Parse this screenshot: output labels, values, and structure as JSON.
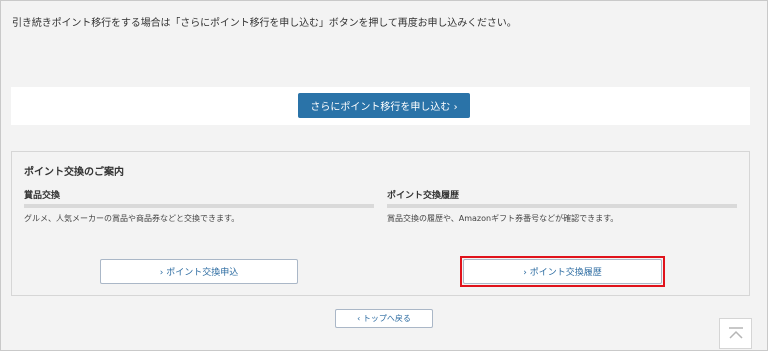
{
  "notice": {
    "text": "引き続きポイント移行をする場合は「さらにポイント移行を申し込む」ボタンを押して再度お申し込みください。"
  },
  "apply_more_button": {
    "label": "さらにポイント移行を申し込む ›"
  },
  "guide": {
    "title": "ポイント交換のご案内",
    "prize_exchange": {
      "title": "賞品交換",
      "description": "グルメ、人気メーカーの賞品や商品券などと交換できます。",
      "button_label": "› ポイント交換申込"
    },
    "history": {
      "title": "ポイント交換履歴",
      "description": "賞品交換の履歴や、Amazonギフト券番号などが確認できます。",
      "button_label": "› ポイント交換履歴"
    }
  },
  "back_to_top_button": {
    "label": "‹ トップへ戻る"
  },
  "page_top": {
    "icon": "arrow-up-bar-icon"
  },
  "colors": {
    "primary": "#2a73a8",
    "highlight": "#e0121b",
    "background": "#f3f3f3"
  }
}
